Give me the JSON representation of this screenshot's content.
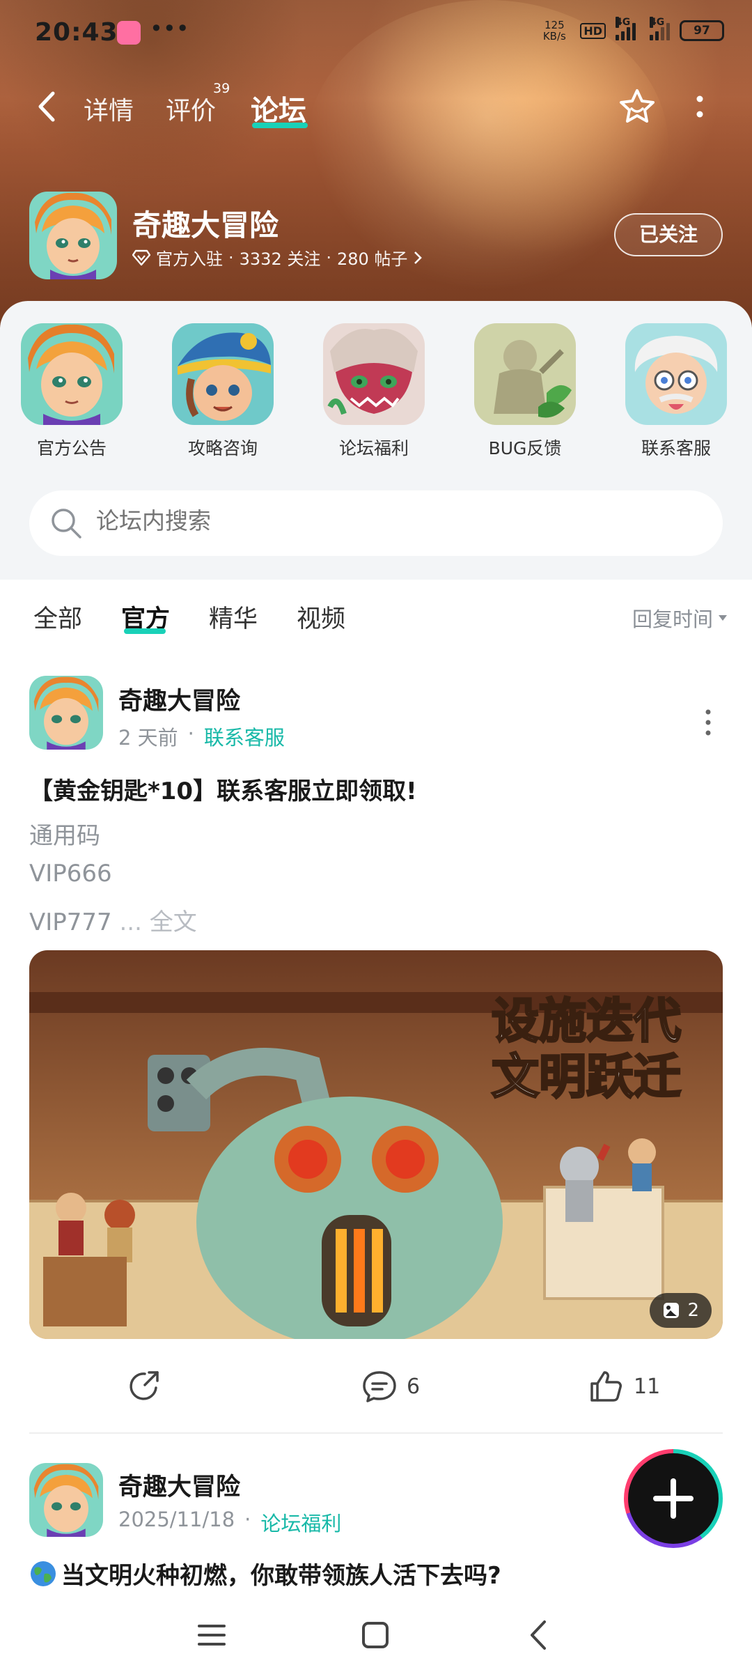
{
  "status_bar": {
    "time": "20:43",
    "more": "•••",
    "net_speed_value": "125",
    "net_speed_unit": "KB/s",
    "hd": "HD",
    "signal1": "4G",
    "signal2": "4G",
    "battery": "97"
  },
  "nav": {
    "tabs": [
      "详情",
      "评价",
      "论坛"
    ],
    "review_badge": "39",
    "active_tab": "论坛"
  },
  "game": {
    "title": "奇趣大冒险",
    "official": "官方入驻",
    "follows": "3332 关注",
    "posts": "280 帖子",
    "separator": "·",
    "follow_button": "已关注"
  },
  "categories": [
    {
      "label": "官方公告",
      "icon": "portrait-hero-icon"
    },
    {
      "label": "攻略咨询",
      "icon": "portrait-pirate-icon"
    },
    {
      "label": "论坛福利",
      "icon": "portrait-dragon-icon"
    },
    {
      "label": "BUG反馈",
      "icon": "portrait-statue-icon"
    },
    {
      "label": "联系客服",
      "icon": "portrait-scientist-icon"
    }
  ],
  "search": {
    "placeholder": "论坛内搜索"
  },
  "filters": {
    "tabs": [
      "全部",
      "官方",
      "精华",
      "视频"
    ],
    "active": "官方",
    "sort_label": "回复时间"
  },
  "posts": [
    {
      "author": "奇趣大冒险",
      "time": "2 天前",
      "separator": "·",
      "tag": "联系客服",
      "title": "【黄金钥匙*10】联系客服立即领取!",
      "lines": [
        "通用码",
        "VIP666",
        "VIP777"
      ],
      "ellipsis": " ...",
      "read_more": " 全文",
      "image_count": "2",
      "image_caption_line1": "设施迭代",
      "image_caption_line2": "文明跃迁",
      "comments": "6",
      "likes": "11"
    },
    {
      "author": "奇趣大冒险",
      "time": "2025/11/18",
      "separator": "·",
      "tag": "论坛福利",
      "title": "当文明火种初燃，你敢带领族人活下去吗?"
    }
  ],
  "colors": {
    "accent": "#19d1b8",
    "tag": "#19b9a8",
    "hero": "#a65a37"
  }
}
